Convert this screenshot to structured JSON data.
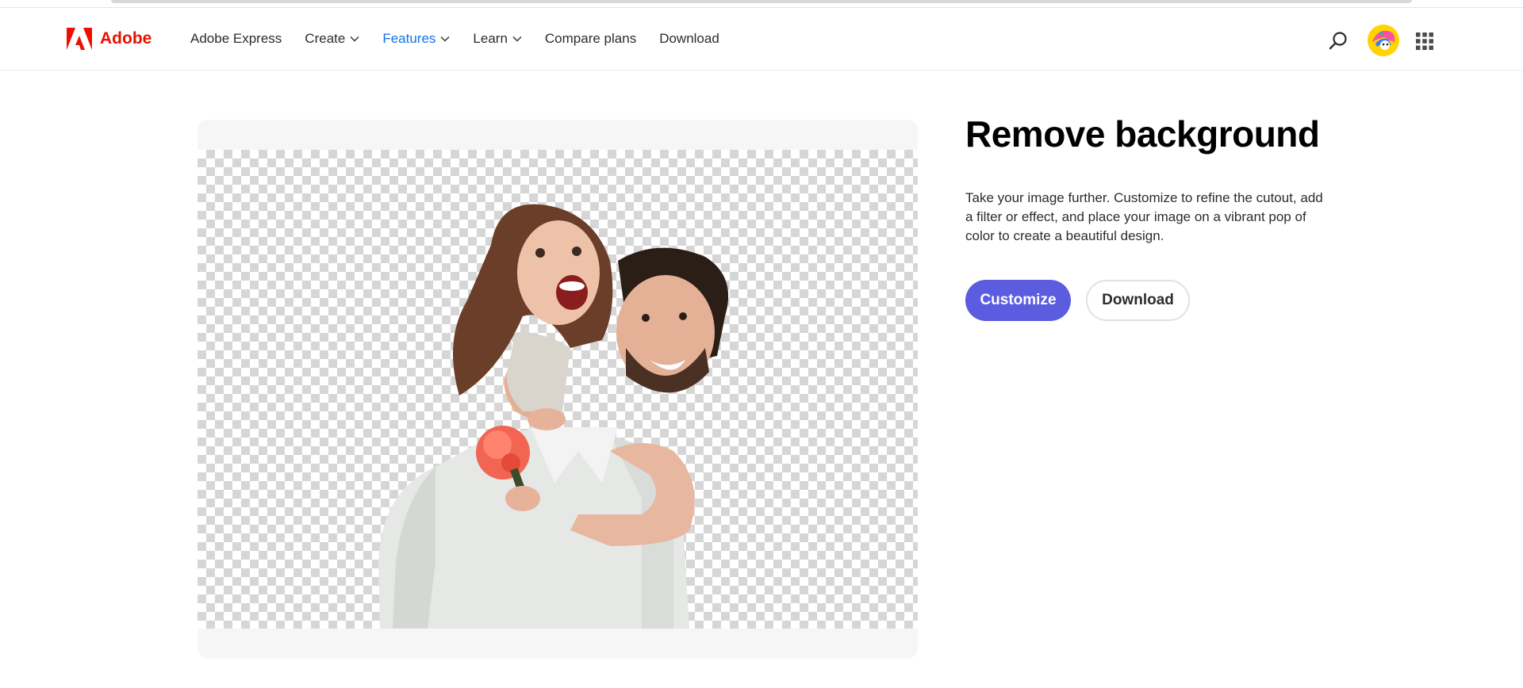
{
  "header": {
    "brand": "Adobe",
    "nav": [
      {
        "label": "Adobe Express",
        "dropdown": false,
        "active": false
      },
      {
        "label": "Create",
        "dropdown": true,
        "active": false
      },
      {
        "label": "Features",
        "dropdown": true,
        "active": true
      },
      {
        "label": "Learn",
        "dropdown": true,
        "active": false
      },
      {
        "label": "Compare plans",
        "dropdown": false,
        "active": false
      },
      {
        "label": "Download",
        "dropdown": false,
        "active": false
      }
    ],
    "icons": {
      "search": "search-icon",
      "avatar": "user-avatar",
      "apps": "app-grid-icon"
    }
  },
  "main": {
    "title": "Remove background",
    "description": "Take your image further. Customize to refine the cutout, add a filter or effect, and place your image on a vibrant pop of color to create a beautiful design.",
    "primary_button": "Customize",
    "secondary_button": "Download"
  },
  "colors": {
    "brand_red": "#eb1000",
    "nav_active": "#1473e6",
    "primary_button": "#5c5ce0"
  }
}
